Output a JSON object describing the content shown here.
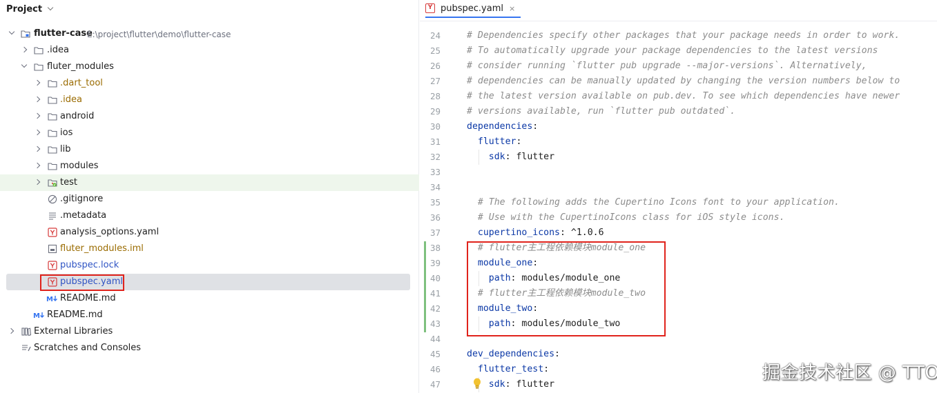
{
  "project_panel": {
    "title": "Project",
    "tree": [
      {
        "label": "flutter-case",
        "path": "E:\\project\\flutter\\demo\\flutter-case",
        "icon": "module-folder-icon",
        "expanded": true
      },
      {
        "label": ".idea",
        "icon": "folder-icon"
      },
      {
        "label": "fluter_modules",
        "icon": "folder-icon",
        "expanded": true
      },
      {
        "label": ".dart_tool",
        "icon": "folder-icon"
      },
      {
        "label": ".idea",
        "icon": "folder-icon"
      },
      {
        "label": "android",
        "icon": "folder-icon"
      },
      {
        "label": "ios",
        "icon": "folder-icon"
      },
      {
        "label": "lib",
        "icon": "folder-icon"
      },
      {
        "label": "modules",
        "icon": "folder-icon"
      },
      {
        "label": "test",
        "icon": "test-folder-icon"
      },
      {
        "label": ".gitignore",
        "icon": "ignore-file-icon"
      },
      {
        "label": ".metadata",
        "icon": "text-file-icon"
      },
      {
        "label": "analysis_options.yaml",
        "icon": "yaml-file-icon"
      },
      {
        "label": "fluter_modules.iml",
        "icon": "iml-file-icon"
      },
      {
        "label": "pubspec.lock",
        "icon": "yaml-file-icon"
      },
      {
        "label": "pubspec.yaml",
        "icon": "yaml-file-icon"
      },
      {
        "label": "README.md",
        "icon": "markdown-file-icon"
      },
      {
        "label": "README.md",
        "icon": "markdown-file-icon"
      },
      {
        "label": "External Libraries",
        "icon": "libraries-icon"
      },
      {
        "label": "Scratches and Consoles",
        "icon": "scratches-icon"
      }
    ]
  },
  "editor": {
    "tab": {
      "label": "pubspec.yaml",
      "icon": "yaml-file-icon",
      "close": "×"
    },
    "lines": [
      {
        "num": "24",
        "text": "# Dependencies specify other packages that your package needs in order to work."
      },
      {
        "num": "25",
        "text": "# To automatically upgrade your package dependencies to the latest versions"
      },
      {
        "num": "26",
        "text": "# consider running `flutter pub upgrade --major-versions`. Alternatively,"
      },
      {
        "num": "27",
        "text": "# dependencies can be manually updated by changing the version numbers below to"
      },
      {
        "num": "28",
        "text": "# the latest version available on pub.dev. To see which dependencies have newer"
      },
      {
        "num": "29",
        "text": "# versions available, run `flutter pub outdated`."
      },
      {
        "num": "30",
        "key": "dependencies",
        "colon": ":"
      },
      {
        "num": "31",
        "indent": "  ",
        "key": "flutter",
        "colon": ":"
      },
      {
        "num": "32",
        "indent": "    ",
        "key": "sdk",
        "colon": ": ",
        "value": "flutter"
      },
      {
        "num": "33"
      },
      {
        "num": "34"
      },
      {
        "num": "35",
        "indent": "  ",
        "text": "# The following adds the Cupertino Icons font to your application."
      },
      {
        "num": "36",
        "indent": "  ",
        "text": "# Use with the CupertinoIcons class for iOS style icons."
      },
      {
        "num": "37",
        "indent": "  ",
        "key": "cupertino_icons",
        "colon": ": ",
        "value": "^1.0.6"
      },
      {
        "num": "38",
        "indent": "  ",
        "text": "# flutter主工程依赖模块module_one"
      },
      {
        "num": "39",
        "indent": "  ",
        "key": "module_one",
        "colon": ":"
      },
      {
        "num": "40",
        "indent": "    ",
        "key": "path",
        "colon": ": ",
        "value": "modules/module_one"
      },
      {
        "num": "41",
        "indent": "  ",
        "text": "# flutter主工程依赖模块module_two"
      },
      {
        "num": "42",
        "indent": "  ",
        "key": "module_two",
        "colon": ":"
      },
      {
        "num": "43",
        "indent": "    ",
        "key": "path",
        "colon": ": ",
        "value": "modules/module_two"
      },
      {
        "num": "44"
      },
      {
        "num": "45",
        "key": "dev_dependencies",
        "colon": ":"
      },
      {
        "num": "46",
        "indent": "  ",
        "key": "flutter_test",
        "colon": ":"
      },
      {
        "num": "47",
        "indent": "    ",
        "key": "sdk",
        "colon": ": ",
        "value": "flutter"
      }
    ]
  },
  "watermark": "掘金技术社区 @ TTO",
  "colors": {
    "highlight_box": "#e0221b",
    "changed_gutter": "#7ec07e",
    "yaml_key": "#0b38a6",
    "comment": "#8c8c8c",
    "selection": "#dfe1e5"
  }
}
